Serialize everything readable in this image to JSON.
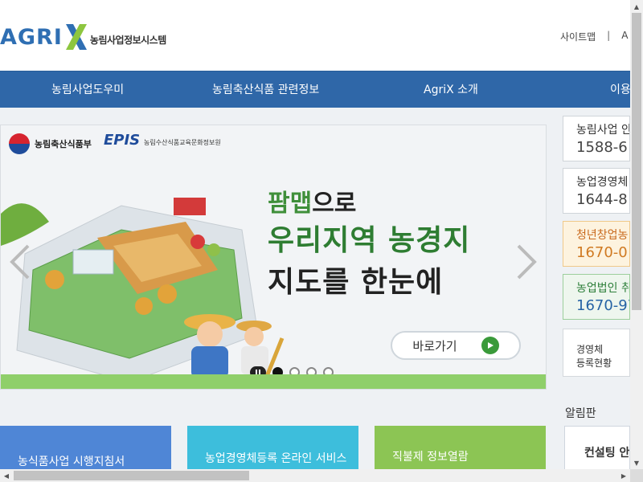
{
  "header": {
    "logo_text": "AGRI",
    "logo_sub": "농림사업정보시스템",
    "util_links": [
      "사이트맵",
      "|",
      "A"
    ]
  },
  "nav": {
    "items": [
      "농림사업도우미",
      "농림축산식품 관련정보",
      "AgriX 소개",
      "이용"
    ]
  },
  "banner": {
    "gov_name": "농림축산식품부",
    "epis": "EPIS",
    "epis_sub": "농림수산식품교육문화정보원",
    "headline_accent": "팜맵",
    "headline_rest": "으로",
    "headline2": "우리지역 농경지",
    "headline3": "지도를 한눈에",
    "button_label": "바로가기",
    "slide_count": 4,
    "active_slide": 1
  },
  "contacts": [
    {
      "title": "농림사업 안",
      "number": "1588-6",
      "style": "plain"
    },
    {
      "title": "농업경영체",
      "number": "1644-8",
      "style": "plain"
    },
    {
      "title": "청년창업농",
      "number": "1670-0",
      "style": "orange"
    },
    {
      "title": "농업법인 취",
      "number": "1670-97",
      "style": "green"
    }
  ],
  "status_box": {
    "line1": "경영체",
    "line2": "등록현황"
  },
  "notice": {
    "title": "알림판",
    "box_text": "컨설팅 안"
  },
  "cards": [
    {
      "label": "농식품사업 시행지침서"
    },
    {
      "label": "농업경영체등록 온라인 서비스"
    },
    {
      "label": "직불제 정보열람"
    }
  ],
  "colors": {
    "nav_bg": "#2f67a8",
    "brand_blue": "#2f6fb3",
    "brand_green": "#8dc63f",
    "card1": "#4f86d6",
    "card2": "#3dbedc",
    "card3": "#8cc554"
  }
}
